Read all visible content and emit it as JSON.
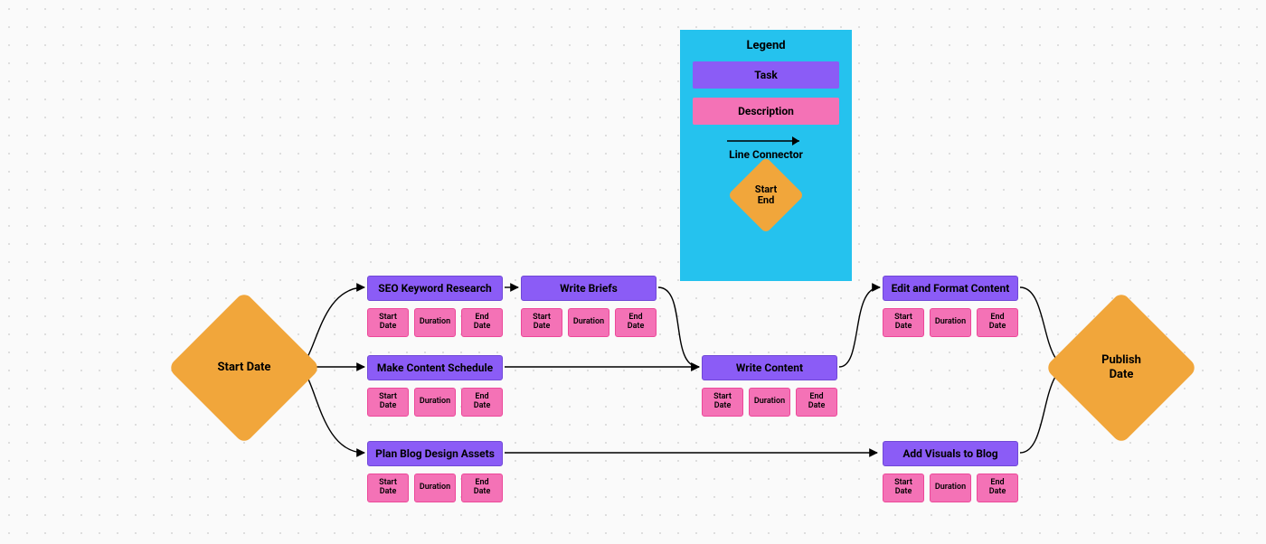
{
  "colors": {
    "task": "#8b5cf6",
    "desc": "#f472b6",
    "diamond": "#f1a63b",
    "legend_bg": "#25c2ee"
  },
  "start": {
    "label": "Start Date"
  },
  "end": {
    "label": "Publish\nDate"
  },
  "chip_labels": {
    "start": "Start\nDate",
    "duration": "Duration",
    "end": "End\nDate"
  },
  "tasks": {
    "seo": {
      "title": "SEO Keyword Research"
    },
    "briefs": {
      "title": "Write Briefs"
    },
    "schedule": {
      "title": "Make Content Schedule"
    },
    "write": {
      "title": "Write Content"
    },
    "plan": {
      "title": "Plan Blog Design Assets"
    },
    "edit": {
      "title": "Edit and Format Content"
    },
    "visuals": {
      "title": "Add Visuals to Blog"
    }
  },
  "legend": {
    "title": "Legend",
    "task_label": "Task",
    "desc_label": "Description",
    "line_label": "Line Connector",
    "startend_label": "Start\nEnd"
  }
}
